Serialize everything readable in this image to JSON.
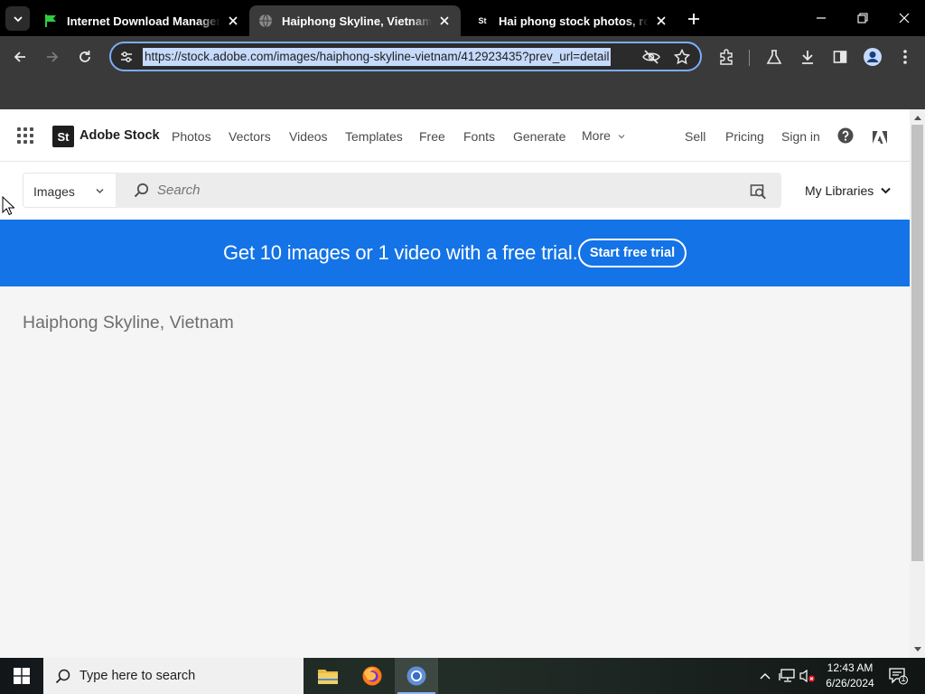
{
  "browser": {
    "tabs": [
      {
        "title": "Internet Download Manager is",
        "favicon": "idm-flag-icon",
        "active": false
      },
      {
        "title": "Haiphong Skyline, Vietnam Sto",
        "favicon": "globe-icon",
        "active": true
      },
      {
        "title": "Hai phong stock photos, royalt",
        "favicon": "adobe-stock-icon",
        "active": false
      }
    ],
    "favicon_text": "St",
    "url": "https://stock.adobe.com/images/haiphong-skyline-vietnam/412923435?prev_url=detail"
  },
  "site": {
    "logo_text": "St",
    "brand": "Adobe Stock",
    "nav": [
      "Photos",
      "Vectors",
      "Videos",
      "Templates",
      "Free",
      "Fonts",
      "Generate"
    ],
    "more_label": "More",
    "right_nav": [
      "Sell",
      "Pricing",
      "Sign in"
    ]
  },
  "search": {
    "type_label": "Images",
    "placeholder": "Search",
    "libraries_label": "My Libraries"
  },
  "banner": {
    "message": "Get 10 images or 1 video with a free trial.",
    "cta": "Start free trial",
    "color": "#1473e6"
  },
  "page": {
    "title": "Haiphong Skyline, Vietnam"
  },
  "taskbar": {
    "search_placeholder": "Type here to search",
    "time": "12:43 AM",
    "date": "6/26/2024",
    "notification_count": "1"
  }
}
